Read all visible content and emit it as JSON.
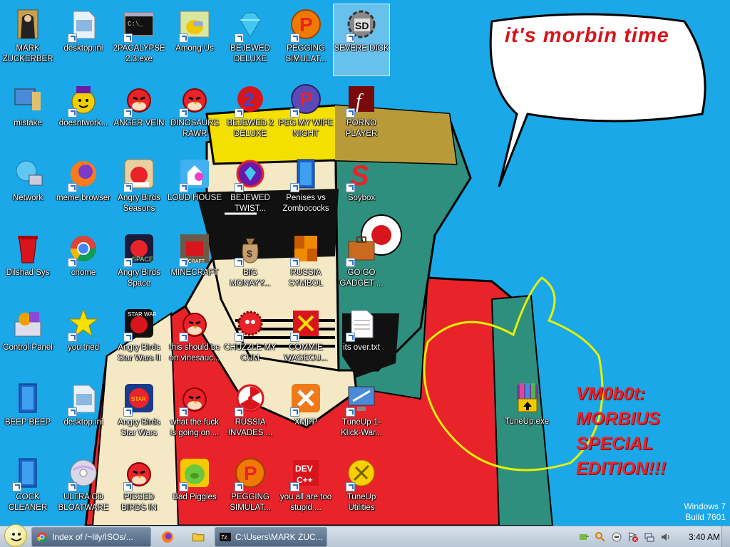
{
  "wallpaper": {
    "speech_bubble": "it's morbin time",
    "caption_lines": [
      "VM0b0t:",
      "MORBIUS",
      "SPECIAL",
      "EDITION!!!"
    ]
  },
  "icons": [
    {
      "label": "MARK ZUCKERBERG",
      "icon": "folder-person-icon",
      "col": 0,
      "row": 0
    },
    {
      "label": "desktop.ini",
      "icon": "settings-file-icon",
      "col": 1,
      "row": 0
    },
    {
      "label": "2PACALYPSE 2.3.exe",
      "icon": "console-icon",
      "col": 2,
      "row": 0
    },
    {
      "label": "Among Us",
      "icon": "among-us-icon",
      "col": 3,
      "row": 0
    },
    {
      "label": "BEJEWED DELUXE",
      "icon": "gem-icon",
      "col": 4,
      "row": 0
    },
    {
      "label": "PEGGING SIMULAT...",
      "icon": "peggle-icon",
      "col": 5,
      "row": 0
    },
    {
      "label": "SEVERE DICK",
      "icon": "gear-sd-icon",
      "col": 6,
      "row": 0,
      "selected": true
    },
    {
      "label": "mistake",
      "icon": "computer-icon",
      "col": 0,
      "row": 1
    },
    {
      "label": "doesntwork...",
      "icon": "yahoo-icon",
      "col": 1,
      "row": 1
    },
    {
      "label": "ANGER VEIN",
      "icon": "angry-bird-icon",
      "col": 2,
      "row": 1
    },
    {
      "label": "DINOSAURS RAWR",
      "icon": "angry-bird-icon",
      "col": 3,
      "row": 1
    },
    {
      "label": "BEJEWED 2 DELUXE",
      "icon": "bejeweled2-icon",
      "col": 4,
      "row": 1
    },
    {
      "label": "PEG MY WIFE NIGHT",
      "icon": "peggle-night-icon",
      "col": 5,
      "row": 1
    },
    {
      "label": "PORNO PLAYER",
      "icon": "flash-icon",
      "col": 6,
      "row": 1
    },
    {
      "label": "Network",
      "icon": "network-icon",
      "col": 0,
      "row": 2
    },
    {
      "label": "meme browser",
      "icon": "firefox-icon",
      "col": 1,
      "row": 2
    },
    {
      "label": "Angry Birds Seasons",
      "icon": "angry-birds-seasons-icon",
      "col": 2,
      "row": 2
    },
    {
      "label": "LOUD HOUSE",
      "icon": "loud-house-icon",
      "col": 3,
      "row": 2
    },
    {
      "label": "BEJEWED TWIST...",
      "icon": "bejeweled-twist-icon",
      "col": 4,
      "row": 2
    },
    {
      "label": "Penises vs Zombococks",
      "icon": "blue-book-icon",
      "col": 5,
      "row": 2
    },
    {
      "label": "Soybox",
      "icon": "soybox-icon",
      "col": 6,
      "row": 2
    },
    {
      "label": "Dilshad Sys",
      "icon": "recycle-bin-icon",
      "col": 0,
      "row": 3
    },
    {
      "label": "chome",
      "icon": "chrome-icon",
      "col": 1,
      "row": 3
    },
    {
      "label": "Angry Birds Space",
      "icon": "angry-birds-space-icon",
      "col": 2,
      "row": 3
    },
    {
      "label": "MINECRAFT",
      "icon": "minecraft-bird-icon",
      "col": 3,
      "row": 3
    },
    {
      "label": "BIG MONAYY...",
      "icon": "money-bag-icon",
      "col": 4,
      "row": 3
    },
    {
      "label": "RUSSIA SYMBOL",
      "icon": "russia-symbol-icon",
      "col": 5,
      "row": 3
    },
    {
      "label": "GO GO GADGET ...",
      "icon": "briefcase-icon",
      "col": 6,
      "row": 3
    },
    {
      "label": "Control Panel",
      "icon": "control-panel-icon",
      "col": 0,
      "row": 4
    },
    {
      "label": "you tried",
      "icon": "star-icon",
      "col": 1,
      "row": 4
    },
    {
      "label": "Angry Birds Star Wars II",
      "icon": "angry-birds-starwars2-icon",
      "col": 2,
      "row": 4
    },
    {
      "label": "this should be on vinesauc...",
      "icon": "angry-bird-icon",
      "col": 3,
      "row": 4
    },
    {
      "label": "CHUZZLE MY CUM",
      "icon": "chuzzle-icon",
      "col": 4,
      "row": 4
    },
    {
      "label": "COMMIE WAGECU...",
      "icon": "commie-icon",
      "col": 5,
      "row": 4
    },
    {
      "label": "its over.txt",
      "icon": "text-file-icon",
      "col": 6,
      "row": 4
    },
    {
      "label": "BEEP BEEP",
      "icon": "blue-book-icon",
      "col": 0,
      "row": 5
    },
    {
      "label": "desktop.ini",
      "icon": "settings-file-icon",
      "col": 1,
      "row": 5
    },
    {
      "label": "Angry Birds Star Wars",
      "icon": "angry-birds-starwars-icon",
      "col": 2,
      "row": 5
    },
    {
      "label": "what the fuck is going on ...",
      "icon": "angry-bird-icon",
      "col": 3,
      "row": 5
    },
    {
      "label": "RUSSIA INVADES ...",
      "icon": "radiation-icon",
      "col": 4,
      "row": 5
    },
    {
      "label": "XMPP",
      "icon": "xampp-icon",
      "col": 5,
      "row": 5
    },
    {
      "label": "TuneUp 1-Klick-War...",
      "icon": "tuneup-monitor-icon",
      "col": 6,
      "row": 5
    },
    {
      "label": "COCK CLEANER",
      "icon": "blue-book-icon",
      "col": 0,
      "row": 6
    },
    {
      "label": "ULTRA CD BLOATWARE",
      "icon": "cd-icon",
      "col": 1,
      "row": 6
    },
    {
      "label": "PISSED BIRDS IN VIDEO G...",
      "icon": "angry-bird-icon",
      "col": 2,
      "row": 6
    },
    {
      "label": "Bad Piggies",
      "icon": "bad-piggies-icon",
      "col": 3,
      "row": 6
    },
    {
      "label": "PEGGING SIMULAT...",
      "icon": "peggle-icon",
      "col": 4,
      "row": 6
    },
    {
      "label": "you all are too stupid ...",
      "icon": "devcpp-icon",
      "col": 5,
      "row": 6
    },
    {
      "label": "TuneUp Utilities",
      "icon": "tuneup-icon",
      "col": 6,
      "row": 6
    }
  ],
  "floating_icon": {
    "label": "TuneUp.exe",
    "icon": "winrar-installer-icon"
  },
  "watermark": {
    "line1": "Windows 7",
    "line2": "Build 7601"
  },
  "taskbar": {
    "start_icon": "start-orb-icon",
    "buttons": [
      {
        "label": "Index of /~lily/ISOs/...",
        "icon": "chrome-icon"
      },
      {
        "label": "",
        "icon": "firefox-icon"
      },
      {
        "label": "",
        "icon": "folder-icon"
      },
      {
        "label": "C:\\Users\\MARK ZUC...",
        "icon": "7zip-icon"
      }
    ],
    "tray_icons": [
      "safely-remove-icon",
      "search-icon",
      "minus-circle-icon",
      "action-center-icon",
      "network-icon",
      "volume-icon"
    ],
    "clock": "3:40 AM"
  },
  "colors": {
    "desktop": "#1aa8e8",
    "shirt": "#e8232a",
    "face_green": "#2e8f7e",
    "bandana": "#f4e000"
  }
}
